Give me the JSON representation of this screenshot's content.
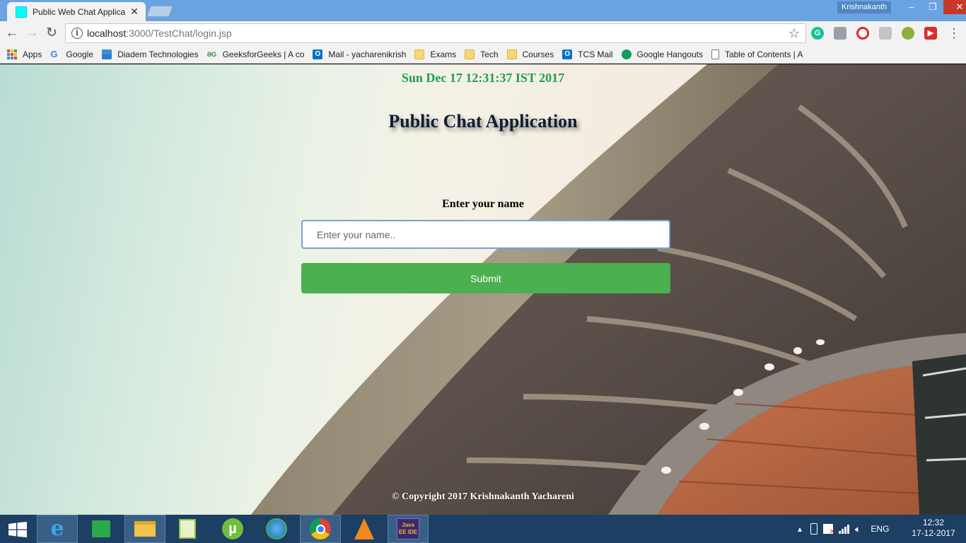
{
  "browser": {
    "tab_title": "Public Web Chat Applica",
    "profile_name": "Krishnakanth",
    "url_host": "localhost",
    "url_path": ":3000/TestChat/login.jsp",
    "window_controls": [
      "–",
      "❐",
      "✕"
    ]
  },
  "bookmarks": [
    {
      "label": "Apps",
      "icon": "apps-icon"
    },
    {
      "label": "Google",
      "icon": "google-icon"
    },
    {
      "label": "Diadem Technologies",
      "icon": "diadem-icon"
    },
    {
      "label": "GeeksforGeeks | A co",
      "icon": "gfg-icon"
    },
    {
      "label": "Mail - yacharenikrish",
      "icon": "outlook-icon"
    },
    {
      "label": "Exams",
      "icon": "folder-icon"
    },
    {
      "label": "Tech",
      "icon": "folder-icon"
    },
    {
      "label": "Courses",
      "icon": "folder-icon"
    },
    {
      "label": "TCS Mail",
      "icon": "outlook-icon"
    },
    {
      "label": "Google Hangouts",
      "icon": "hangouts-icon"
    },
    {
      "label": "Table of Contents | A",
      "icon": "page-icon"
    }
  ],
  "page": {
    "datetime": "Sun Dec 17 12:31:37 IST 2017",
    "heading": "Public Chat Application",
    "name_label": "Enter your name",
    "name_placeholder": "Enter your name..",
    "submit_label": "Submit",
    "footer": "© Copyright 2017 Krishnakanth Yachareni"
  },
  "taskbar": {
    "apps": [
      "start",
      "internet-explorer",
      "store",
      "file-explorer",
      "notepad-plus-plus",
      "utorrent",
      "internet-download-manager",
      "chrome",
      "vlc",
      "java-ee-ide"
    ],
    "java_label": "Java EE IDE",
    "language": "ENG",
    "time": "12:32",
    "date": "17-12-2017"
  },
  "colors": {
    "datetime": "#1f9d55",
    "submit": "#4caf50",
    "titlebar": "#6aa3df",
    "taskbar": "#1c3f63"
  }
}
